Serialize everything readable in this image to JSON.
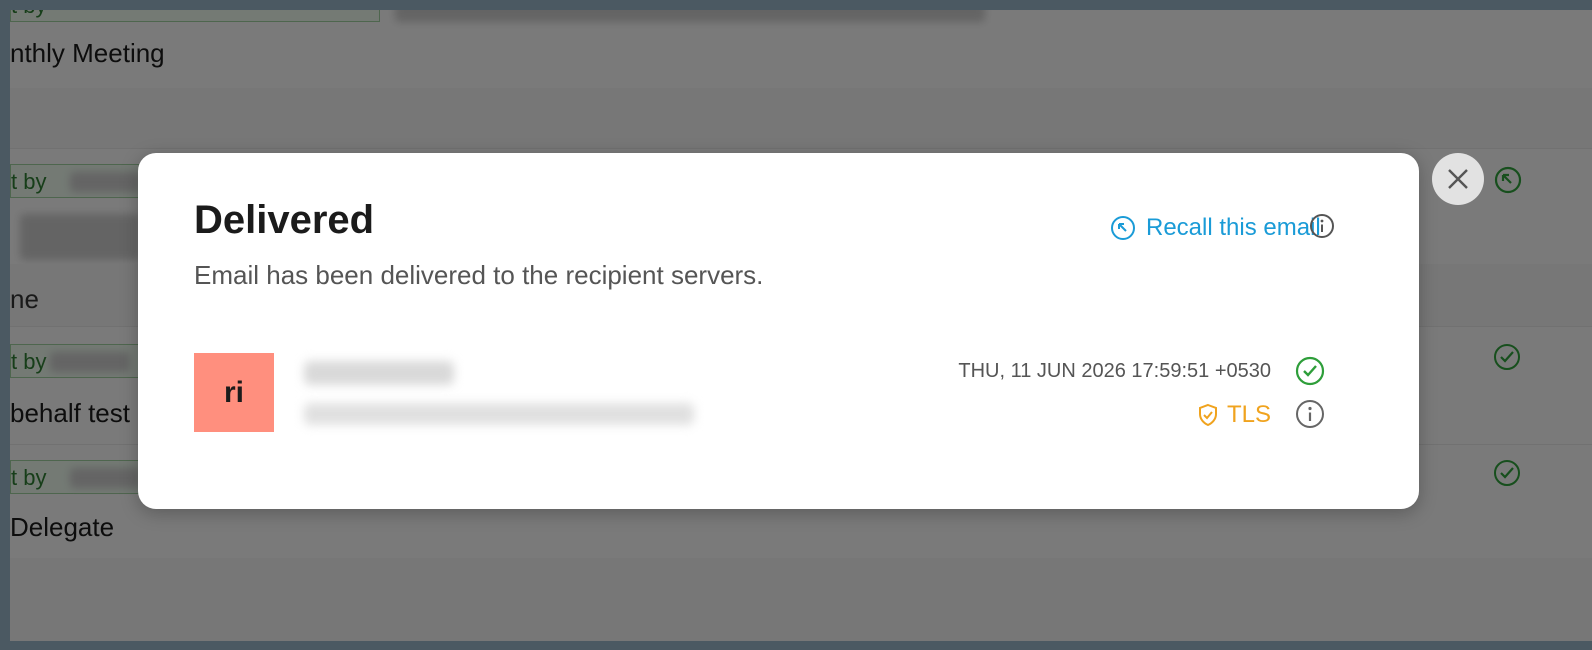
{
  "background": {
    "row_titles": [
      "nthly Meeting",
      "ne",
      "behalf test",
      " Delegate"
    ],
    "sent_by_label": "t by"
  },
  "modal": {
    "title": "Delivered",
    "subtitle": "Email has been delivered to the recipient servers.",
    "recall_label": "Recall this email",
    "recipient": {
      "avatar_initials": "ri",
      "timestamp": "THU, 11 JUN 2026 17:59:51 +0530",
      "security_label": "TLS"
    }
  },
  "colors": {
    "accent": "#1a9bd7",
    "success": "#2e9e3a",
    "warning": "#f0a31e",
    "avatar": "#ff8f7e"
  },
  "icons": [
    "recall-icon",
    "info-icon",
    "check-circle-icon",
    "shield-check-icon",
    "close-icon"
  ]
}
